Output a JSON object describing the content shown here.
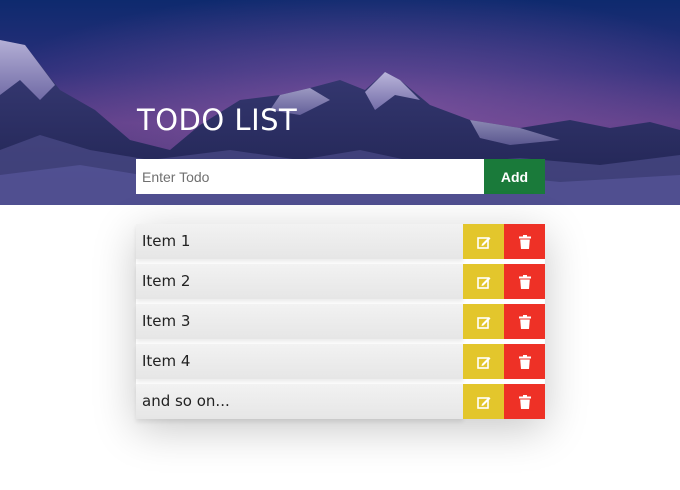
{
  "header": {
    "title": "TODO LIST"
  },
  "form": {
    "input_value": "",
    "placeholder": "Enter Todo",
    "add_label": "Add"
  },
  "todos": [
    {
      "text": "Item 1"
    },
    {
      "text": "Item 2"
    },
    {
      "text": "Item 3"
    },
    {
      "text": "Item 4"
    },
    {
      "text": "and so on..."
    }
  ],
  "icons": {
    "edit": "edit-icon",
    "delete": "trash-icon"
  },
  "colors": {
    "add": "#1a7a3a",
    "edit": "#e3c62c",
    "delete": "#ee3126"
  }
}
